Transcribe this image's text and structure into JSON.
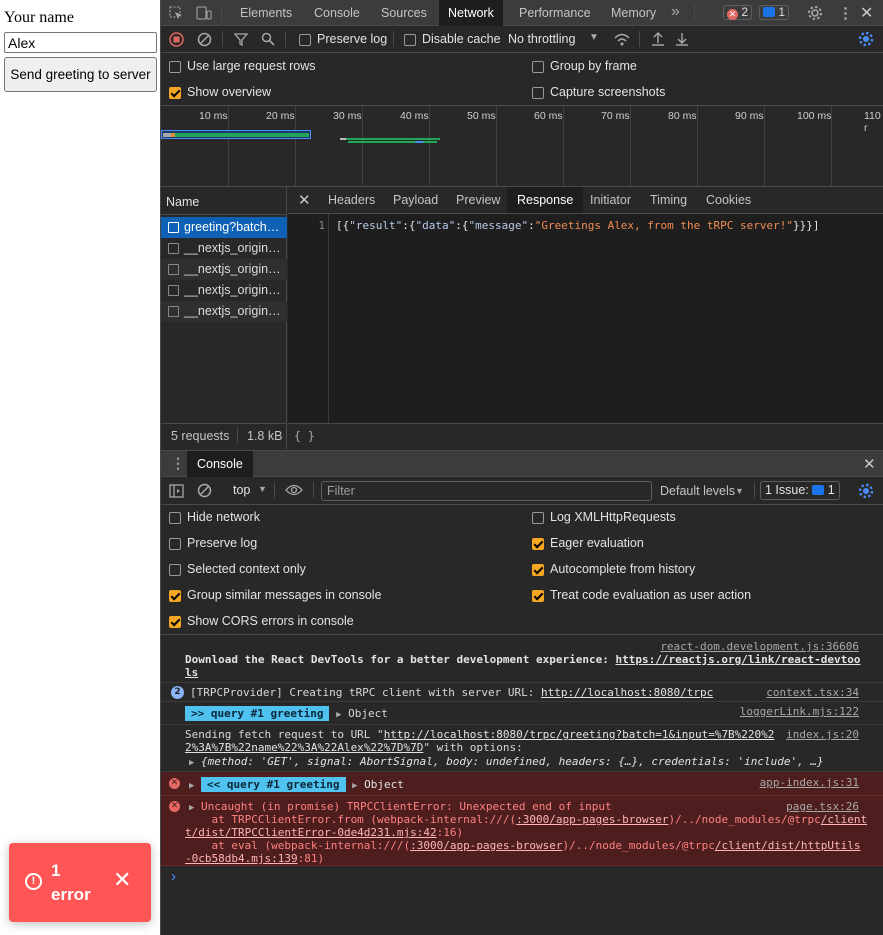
{
  "app": {
    "name_label": "Your name",
    "name_value": "Alex",
    "send_button": "Send greeting to server",
    "error_toast": {
      "count": "1",
      "label": "error",
      "close": "✕",
      "icon": "!"
    }
  },
  "devtools": {
    "tabs": [
      "Elements",
      "Console",
      "Sources",
      "Network",
      "Performance",
      "Memory"
    ],
    "more_tabs": "»",
    "error_count": "2",
    "message_count": "1",
    "network_toolbar": {
      "preserve_log": "Preserve log",
      "disable_cache": "Disable cache",
      "throttling": "No throttling"
    },
    "network_settings": {
      "large_rows": "Use large request rows",
      "group_by_frame": "Group by frame",
      "show_overview": "Show overview",
      "capture_screenshots": "Capture screenshots"
    },
    "overview_ticks": [
      "10 ms",
      "20 ms",
      "30 ms",
      "40 ms",
      "50 ms",
      "60 ms",
      "70 ms",
      "80 ms",
      "90 ms",
      "100 ms",
      "110 r"
    ],
    "request_list_header": "Name",
    "requests": [
      "greeting?batch…",
      "__nextjs_origin…",
      "__nextjs_origin…",
      "__nextjs_origin…",
      "__nextjs_origin…"
    ],
    "summary": {
      "requests": "5 requests",
      "size": "1.8 kB"
    },
    "detail_tabs": [
      "Headers",
      "Payload",
      "Preview",
      "Response",
      "Initiator",
      "Timing",
      "Cookies"
    ],
    "response": {
      "line_number": "1",
      "body": "[{\"result\":{\"data\":{\"message\":\"Greetings Alex, from the tRPC server!\"}}}]"
    },
    "pretty_print": "{ }",
    "console": {
      "drawer_tab": "Console",
      "context": "top",
      "filter_placeholder": "Filter",
      "levels": "Default levels",
      "issues": "1 Issue:",
      "issues_count": "1",
      "settings": {
        "hide_network": "Hide network",
        "log_xhr": "Log XMLHttpRequests",
        "preserve_log": "Preserve log",
        "eager_eval": "Eager evaluation",
        "selected_context": "Selected context only",
        "autocomplete": "Autocomplete from history",
        "group_similar": "Group similar messages in console",
        "treat_user_action": "Treat code evaluation as user action",
        "cors_errors": "Show CORS errors in console"
      },
      "messages": {
        "m1_src": "react-dom.development.js:36606",
        "m1_text": "Download the React DevTools for a better development experience: ",
        "m1_link1": "https://reactjs.org/link/react-devtoo",
        "m1_link2": "ls",
        "m2_count": "2",
        "m2_text": "[TRPCProvider] Creating tRPC client with server URL: ",
        "m2_link": "http://localhost:8080/trpc",
        "m2_src": "context.tsx:34",
        "m3_pill": ">> query #1  greeting",
        "m3_obj": "Object",
        "m3_src": "loggerLink.mjs:122",
        "m4_text1": "Sending fetch request to URL \"",
        "m4_link1": "http://localhost:8080/trpc/greeting?batch=1&input=%7B%220%2",
        "m4_link2": "2%3A%7B%22name%22%3A%22Alex%22%7D%7D",
        "m4_text2": "\" with options:",
        "m4_src": "index.js:20",
        "m4_obj": "{method: 'GET', signal: AbortSignal, body: undefined, headers: {…}, credentials: 'include', …}",
        "m5_pill": "<< query #1  greeting",
        "m5_obj": "Object",
        "m5_src": "app-index.js:31",
        "m6_line1": "Uncaught (in promise) TRPCClientError: Unexpected end of input",
        "m6_src": "page.tsx:26",
        "m6_line2a": "    at TRPCClientError.from (webpack-internal:///(",
        "m6_line2_link": ":3000/app-pages-browser",
        "m6_line2b": ")/../node_modules/@trpc",
        "m6_line2_link2": "/client",
        "m6_line3_link": "t/dist/TRPCClientError-0de4d231.mjs:42",
        "m6_line3b": ":16)",
        "m6_line4a": "    at eval (webpack-internal:///(",
        "m6_line4_link": ":3000/app-pages-browser",
        "m6_line4b": ")/../node_modules/@trpc",
        "m6_line4_link2": "/client/dist/httpUtils",
        "m6_line5_link": "-0cb58db4.mjs:139",
        "m6_line5b": ":81)"
      },
      "prompt": "›"
    }
  }
}
